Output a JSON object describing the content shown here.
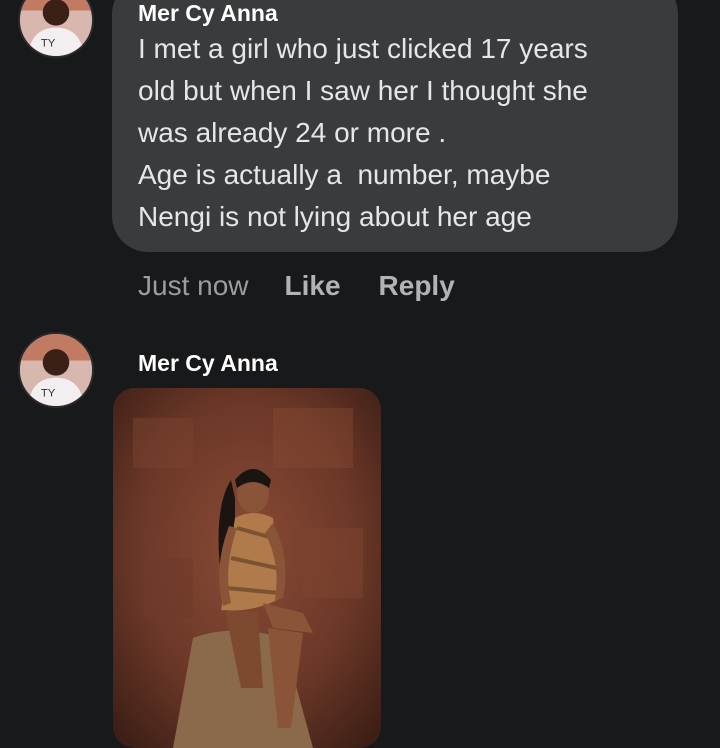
{
  "comments": [
    {
      "author": "Mer Cy Anna",
      "text": "I met a girl who just clicked 17 years\nold but when I saw her I thought she\nwas already 24 or more .\nAge is actually a  number, maybe\nNengi is not lying about her age",
      "time": "Just now",
      "like_label": "Like",
      "reply_label": "Reply"
    },
    {
      "author": "Mer Cy Anna",
      "attachment": "photo"
    }
  ],
  "colors": {
    "background": "#18191a",
    "bubble": "#3a3b3c",
    "action_text": "#b0b3b8"
  }
}
